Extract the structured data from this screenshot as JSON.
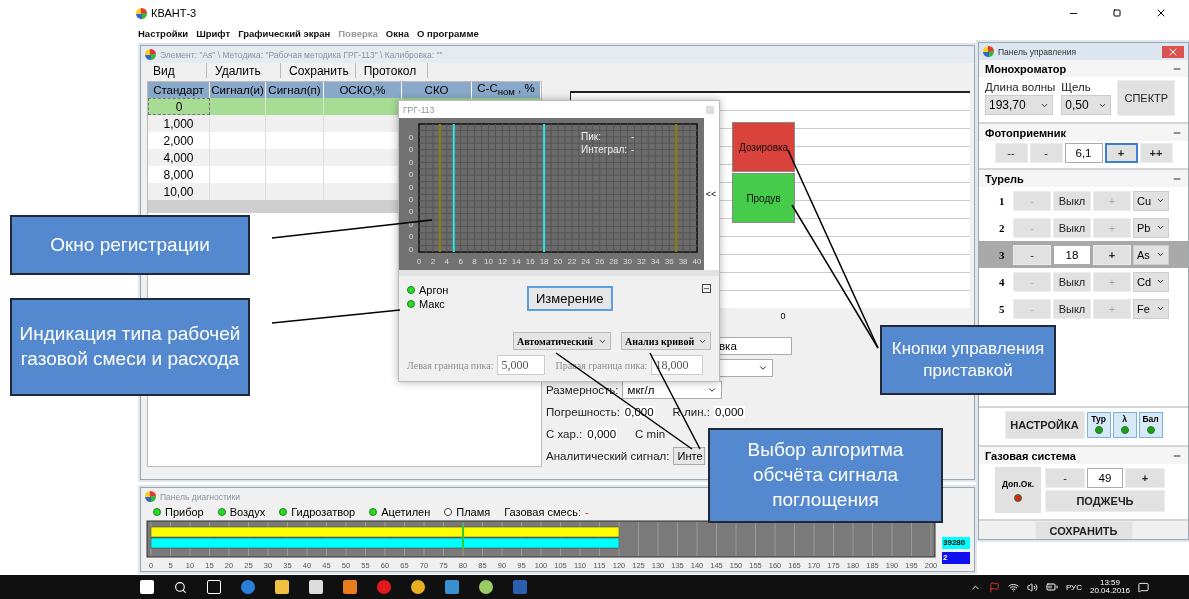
{
  "app": {
    "title": "КВАНТ-3",
    "menu": [
      {
        "label": "Настройки",
        "disabled": false
      },
      {
        "label": "Шрифт",
        "disabled": false
      },
      {
        "label": "Графический экран",
        "disabled": false
      },
      {
        "label": "Поверка",
        "disabled": true
      },
      {
        "label": "Окна",
        "disabled": false
      },
      {
        "label": "О программе",
        "disabled": false
      }
    ]
  },
  "main_window": {
    "title": "Элемент: \"As\" \\ Методика: \"Рабочая методика ГРГ-113\" \\ Калибровка: \"\"",
    "toolbar": [
      "Вид",
      "Удалить",
      "Сохранить",
      "Протокол"
    ],
    "table": {
      "columns": [
        "Стандарт",
        "Сигнал(и)",
        "Сигнал(п)",
        "ОСКО,%",
        "СКО",
        "С-С$_{ном}$ , %"
      ],
      "rows": [
        {
          "standard": "0",
          "selected": true
        },
        {
          "standard": "1,000",
          "selected": false
        },
        {
          "standard": "2,000",
          "selected": false
        },
        {
          "standard": "4,000",
          "selected": false
        },
        {
          "standard": "8,000",
          "selected": false
        },
        {
          "standard": "10,00",
          "selected": false
        }
      ]
    },
    "plot_label": "0",
    "name_value": "вка",
    "unit_label": "Размерность:",
    "unit": "мкг/л",
    "stats": [
      {
        "label": "Погрешность:",
        "value": "0,000"
      },
      {
        "label": "R лин.:",
        "value": "0,000"
      },
      {
        "label": "С хар.:",
        "value": "0,000"
      },
      {
        "label": "С min"
      }
    ],
    "signal_label": "Аналитический сигнал:",
    "signal_value": "Инте"
  },
  "dialog": {
    "title": "ГРГ-113",
    "peak_label": "Пик:",
    "peak_value": "-",
    "integral_label": "Интеграл:",
    "integral_value": "-",
    "x_labels": [
      "0",
      "2",
      "4",
      "6",
      "8",
      "10",
      "12",
      "14",
      "16",
      "18",
      "20",
      "22",
      "24",
      "26",
      "28",
      "30",
      "32",
      "34",
      "36",
      "38",
      "40"
    ],
    "y_labels": [
      "0",
      "0",
      "0",
      "0",
      "0",
      "0",
      "0",
      "0",
      "0",
      "0"
    ],
    "collapse_label": "<<",
    "indicators": [
      {
        "label": "Аргон",
        "on": true
      },
      {
        "label": "Макс",
        "on": true
      }
    ],
    "measure_button": "Измерение",
    "mode": "Автоматический",
    "method": "Анализ кривой",
    "left_label": "Левая граница пика:",
    "left_value": "5,000",
    "right_label": "Правая граница пика:",
    "right_value": "18,000"
  },
  "device_buttons": [
    {
      "label": "Дозировка",
      "color": "#d9433b"
    },
    {
      "label": "Продув",
      "color": "#46cc4a"
    }
  ],
  "control_panel": {
    "title": "Панель управления",
    "mono": {
      "title": "Монохроматор",
      "wave_label": "Длина волны",
      "wave": "193,70",
      "slit_label": "Щель",
      "slit": "0,50",
      "button": "СПЕКТР"
    },
    "photo": {
      "title": "Фотоприемник",
      "buttons": [
        "--",
        "-",
        "+",
        "++"
      ],
      "value": "6,1"
    },
    "turret": {
      "title": "Турель",
      "minus": "-",
      "plus": "+",
      "rows": [
        {
          "number": "1",
          "value": "Выкл",
          "element": "Cu",
          "selected": false
        },
        {
          "number": "2",
          "value": "Выкл",
          "element": "Pb",
          "selected": false
        },
        {
          "number": "3",
          "value": "18",
          "element": "As",
          "selected": true
        },
        {
          "number": "4",
          "value": "Выкл",
          "element": "Cd",
          "selected": false
        },
        {
          "number": "5",
          "value": "Выкл",
          "element": "Fe",
          "selected": false
        }
      ]
    },
    "setup_button": "НАСТРОЙКА",
    "status": [
      {
        "label": "Тур",
        "on": true
      },
      {
        "label": "λ",
        "on": true
      },
      {
        "label": "Бал",
        "on": true
      }
    ],
    "gas": {
      "title": "Газовая система",
      "extra_label": "Доп.Ок.",
      "extra_on": true,
      "minus": "-",
      "value": "49",
      "plus": "+",
      "ignite": "ПОДЖЕЧЬ"
    },
    "save_button": "СОХРАНИТЬ"
  },
  "diagnostics": {
    "title": "Панель диагностики",
    "indicators": [
      {
        "label": "Прибор",
        "on": true
      },
      {
        "label": "Воздух",
        "on": true
      },
      {
        "label": "Гидрозатвор",
        "on": true
      },
      {
        "label": "Ацетилен",
        "on": true
      },
      {
        "label": "Пламя",
        "on": false
      }
    ],
    "mix_label": "Газовая смесь:",
    "mix_value": "-",
    "bars": [
      {
        "color": "#ffff00",
        "level": 0.6
      },
      {
        "color": "#00ffff",
        "level": 0.6
      }
    ],
    "scale": [
      "0",
      "5",
      "10",
      "15",
      "20",
      "25",
      "30",
      "35",
      "40",
      "45",
      "50",
      "55",
      "60",
      "65",
      "70",
      "75",
      "80",
      "85",
      "90",
      "95",
      "100",
      "105",
      "110",
      "115",
      "120",
      "125",
      "130",
      "135",
      "140",
      "145",
      "150",
      "155",
      "160",
      "165",
      "170",
      "175",
      "180",
      "185",
      "190",
      "195",
      "200"
    ],
    "readouts": [
      "39280",
      "2"
    ]
  },
  "callouts": [
    "Окно регистрации",
    "Индикация типа рабочей газовой смеси и расхода",
    "Кнопки управления приставкой",
    "Выбор алгоритма обсчёта сигнала поглощения"
  ],
  "taskbar": {
    "language": "РУС",
    "time": "13:59",
    "date": "20.04.2016"
  }
}
